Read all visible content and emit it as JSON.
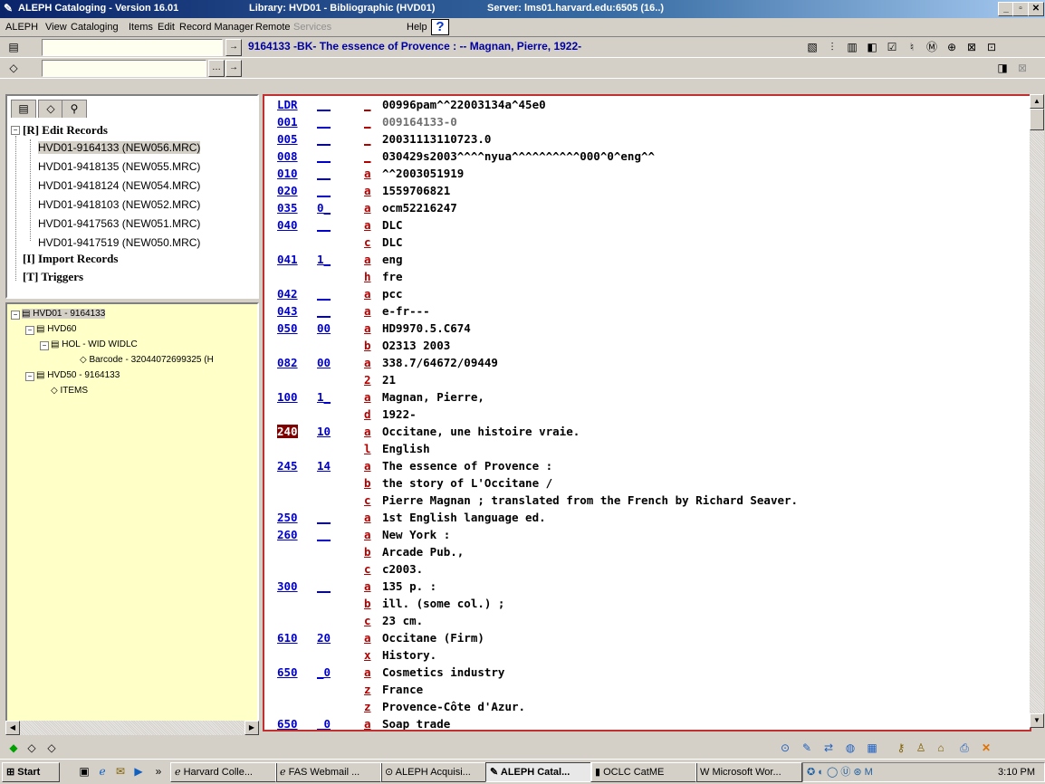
{
  "window": {
    "title": "ALEPH Cataloging - Version 16.01",
    "library": "Library: HVD01 - Bibliographic (HVD01)",
    "server": "Server: lms01.harvard.edu:6505 (16..)"
  },
  "menu": [
    "ALEPH",
    "View",
    "Cataloging",
    "Items",
    "Edit",
    "Record Manager",
    "Remote",
    "Services",
    "Help"
  ],
  "toolbar": {
    "record_title": "9164133 -BK- The essence of Provence : -- Magnan, Pierre, 1922-",
    "search1": "",
    "search2": ""
  },
  "left_tree": {
    "edit_records": "[R] Edit Records",
    "records": [
      "HVD01-9164133 (NEW056.MRC)",
      "HVD01-9418135 (NEW055.MRC)",
      "HVD01-9418124 (NEW054.MRC)",
      "HVD01-9418103 (NEW052.MRC)",
      "HVD01-9417563 (NEW051.MRC)",
      "HVD01-9417519 (NEW050.MRC)"
    ],
    "import_records": "[I] Import Records",
    "triggers": "[T] Triggers"
  },
  "holdings_tree": {
    "root": "HVD01 - 9164133",
    "hvd60": "HVD60",
    "hol": "HOL - WID WIDLC",
    "barcode": "Barcode - 32044072699325 (H",
    "hvd50": "HVD50 - 9164133",
    "items": "ITEMS"
  },
  "record": [
    {
      "tag": "LDR",
      "ind": "__",
      "sub": "_",
      "val": "00996pam^^22003134a^45e0"
    },
    {
      "tag": "001",
      "ind": "__",
      "sub": "_",
      "val": "009164133-0",
      "grey": true
    },
    {
      "tag": "005",
      "ind": "__",
      "sub": "_",
      "val": "20031113110723.0"
    },
    {
      "tag": "008",
      "ind": "__",
      "sub": "_",
      "val": "030429s2003^^^^nyua^^^^^^^^^^000^0^eng^^"
    },
    {
      "tag": "010",
      "ind": "__",
      "sub": "a",
      "val": "^^2003051919"
    },
    {
      "tag": "020",
      "ind": "__",
      "sub": "a",
      "val": "1559706821"
    },
    {
      "tag": "035",
      "ind": "0_",
      "sub": "a",
      "val": "ocm52216247"
    },
    {
      "tag": "040",
      "ind": "__",
      "sub": "a",
      "val": "DLC"
    },
    {
      "tag": "",
      "ind": "",
      "sub": "c",
      "val": "DLC"
    },
    {
      "tag": "041",
      "ind": "1_",
      "sub": "a",
      "val": "eng"
    },
    {
      "tag": "",
      "ind": "",
      "sub": "h",
      "val": "fre"
    },
    {
      "tag": "042",
      "ind": "__",
      "sub": "a",
      "val": "pcc"
    },
    {
      "tag": "043",
      "ind": "__",
      "sub": "a",
      "val": "e-fr---"
    },
    {
      "tag": "050",
      "ind": "00",
      "sub": "a",
      "val": "HD9970.5.C674"
    },
    {
      "tag": "",
      "ind": "",
      "sub": "b",
      "val": "O2313 2003"
    },
    {
      "tag": "082",
      "ind": "00",
      "sub": "a",
      "val": "338.7/64672/09449"
    },
    {
      "tag": "",
      "ind": "",
      "sub": "2",
      "val": "21"
    },
    {
      "tag": "100",
      "ind": "1_",
      "sub": "a",
      "val": "Magnan, Pierre,"
    },
    {
      "tag": "",
      "ind": "",
      "sub": "d",
      "val": "1922-"
    },
    {
      "tag": "240",
      "ind": "10",
      "sub": "a",
      "val": "Occitane, une histoire vraie.",
      "highlight": true
    },
    {
      "tag": "",
      "ind": "",
      "sub": "l",
      "val": "English"
    },
    {
      "tag": "245",
      "ind": "14",
      "sub": "a",
      "val": "The essence of Provence :"
    },
    {
      "tag": "",
      "ind": "",
      "sub": "b",
      "val": "the story of L'Occitane /"
    },
    {
      "tag": "",
      "ind": "",
      "sub": "c",
      "val": "Pierre Magnan ; translated from the French by Richard Seaver."
    },
    {
      "tag": "250",
      "ind": "__",
      "sub": "a",
      "val": "1st English language ed."
    },
    {
      "tag": "260",
      "ind": "__",
      "sub": "a",
      "val": "New York :"
    },
    {
      "tag": "",
      "ind": "",
      "sub": "b",
      "val": "Arcade Pub.,"
    },
    {
      "tag": "",
      "ind": "",
      "sub": "c",
      "val": "c2003."
    },
    {
      "tag": "300",
      "ind": "__",
      "sub": "a",
      "val": "135 p. :"
    },
    {
      "tag": "",
      "ind": "",
      "sub": "b",
      "val": "ill. (some col.) ;"
    },
    {
      "tag": "",
      "ind": "",
      "sub": "c",
      "val": "23 cm."
    },
    {
      "tag": "610",
      "ind": "20",
      "sub": "a",
      "val": "Occitane (Firm)"
    },
    {
      "tag": "",
      "ind": "",
      "sub": "x",
      "val": "History."
    },
    {
      "tag": "650",
      "ind": "_0",
      "sub": "a",
      "val": "Cosmetics industry"
    },
    {
      "tag": "",
      "ind": "",
      "sub": "z",
      "val": "France"
    },
    {
      "tag": "",
      "ind": "",
      "sub": "z",
      "val": "Provence-Côte d'Azur."
    },
    {
      "tag": "650",
      "ind": "_0",
      "sub": "a",
      "val": "Soap trade"
    }
  ],
  "taskbar": {
    "start": "Start",
    "buttons": [
      "Harvard Colle...",
      "FAS Webmail ...",
      "ALEPH Acquisi...",
      "ALEPH Catal...",
      "OCLC CatME",
      "Microsoft Wor..."
    ],
    "clock": "3:10 PM"
  }
}
